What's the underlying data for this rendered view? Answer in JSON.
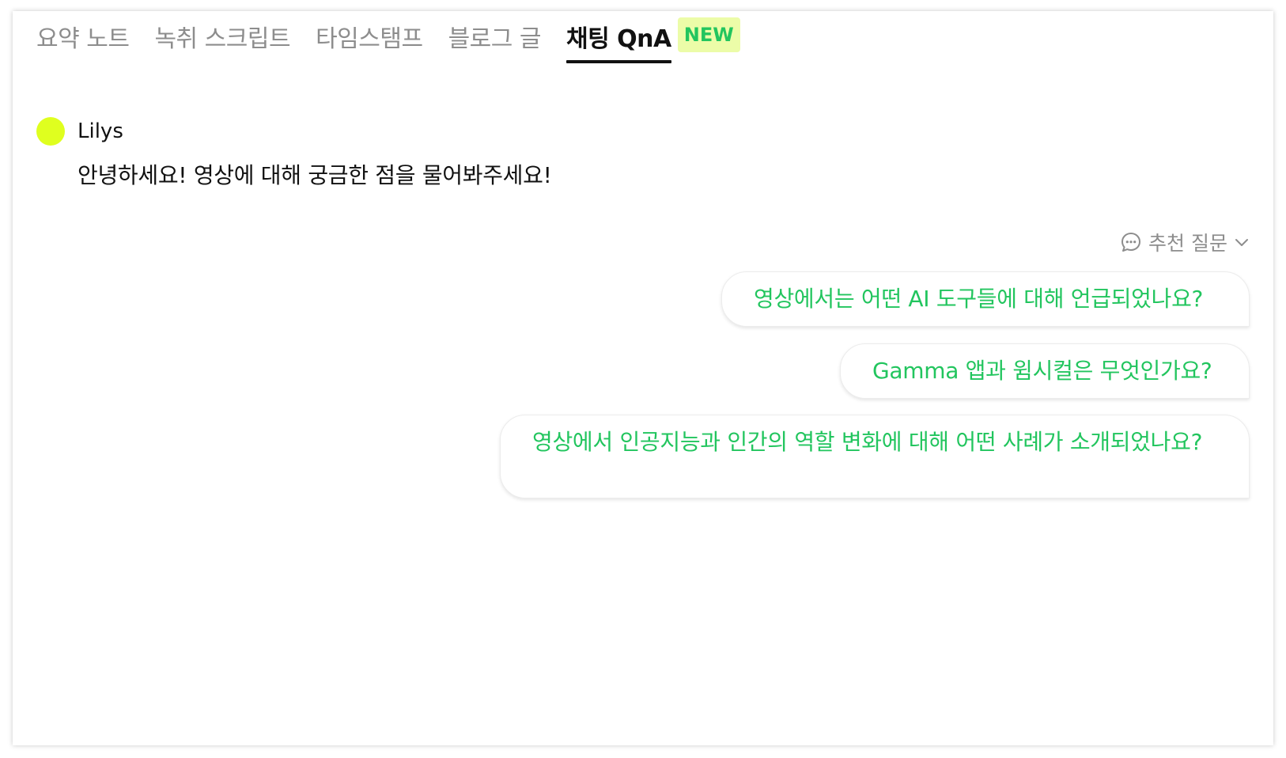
{
  "tabs": [
    {
      "label": "요약 노트"
    },
    {
      "label": "녹취 스크립트"
    },
    {
      "label": "타임스탬프"
    },
    {
      "label": "블로그 글"
    },
    {
      "label": "채팅 QnA",
      "active": true,
      "badge": "NEW"
    }
  ],
  "colors": {
    "accent_green": "#22c55e",
    "avatar": "#dfff1f",
    "badge_bg": "#ecfca8"
  },
  "chat": {
    "bot_name": "Lilys",
    "bot_avatar_icon": "avatar-circle",
    "greeting": "안녕하세요! 영상에 대해 궁금한 점을 물어봐주세요!"
  },
  "suggested": {
    "toggle_label": "추천 질문",
    "toggle_icon": "chat-bubble-icon",
    "chevron_icon": "chevron-down-icon",
    "questions": [
      "영상에서는 어떤 AI 도구들에 대해 언급되었나요?",
      "Gamma 앱과 윔시컬은 무엇인가요?",
      "영상에서 인공지능과 인간의 역할 변화에 대해 어떤 사례가 소개되었나요?"
    ]
  }
}
